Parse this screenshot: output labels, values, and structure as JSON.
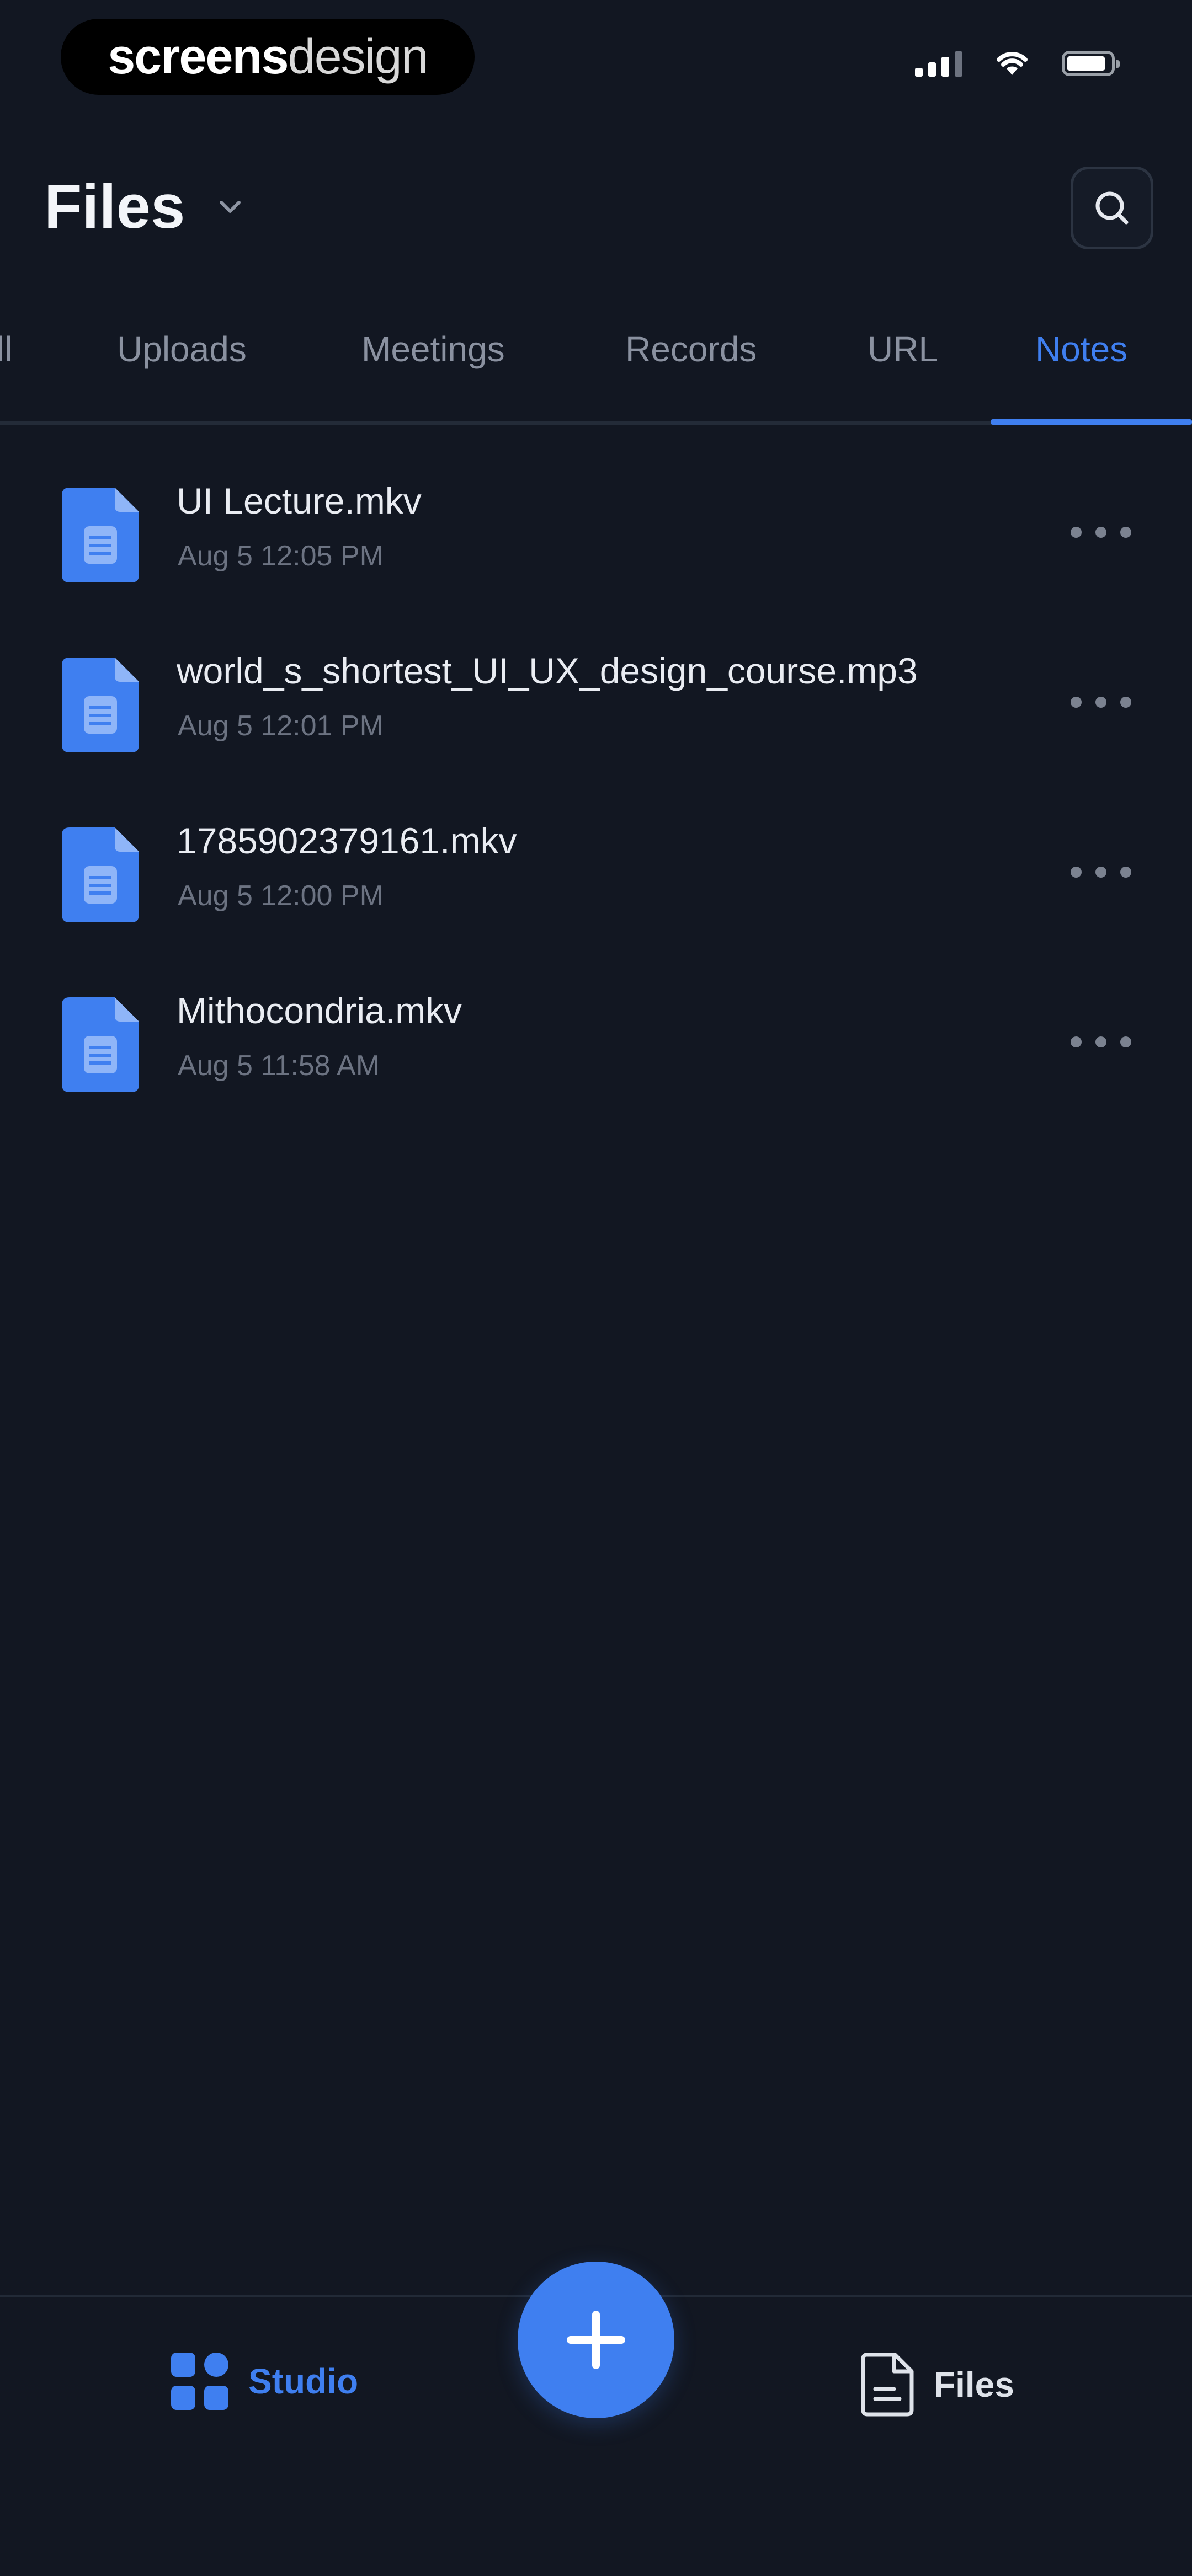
{
  "status_bar": {
    "brand_part1": "screens",
    "brand_part2": "design"
  },
  "header": {
    "title": "Files"
  },
  "tabs": [
    {
      "label": "ll",
      "active": false
    },
    {
      "label": "Uploads",
      "active": false
    },
    {
      "label": "Meetings",
      "active": false
    },
    {
      "label": "Records",
      "active": false
    },
    {
      "label": "URL",
      "active": false
    },
    {
      "label": "Notes",
      "active": true
    }
  ],
  "files": [
    {
      "name": "UI Lecture.mkv",
      "date": "Aug 5 12:05 PM"
    },
    {
      "name": "world_s_shortest_UI_UX_design_course.mp3",
      "date": "Aug 5 12:01 PM"
    },
    {
      "name": "1785902379161.mkv",
      "date": "Aug 5 12:00 PM"
    },
    {
      "name": "Mithocondria.mkv",
      "date": "Aug 5 11:58 AM"
    }
  ],
  "bottom_nav": {
    "studio_label": "Studio",
    "files_label": "Files"
  },
  "colors": {
    "background": "#121722",
    "accent": "#3f7ff0",
    "muted_text": "#6c7382"
  }
}
